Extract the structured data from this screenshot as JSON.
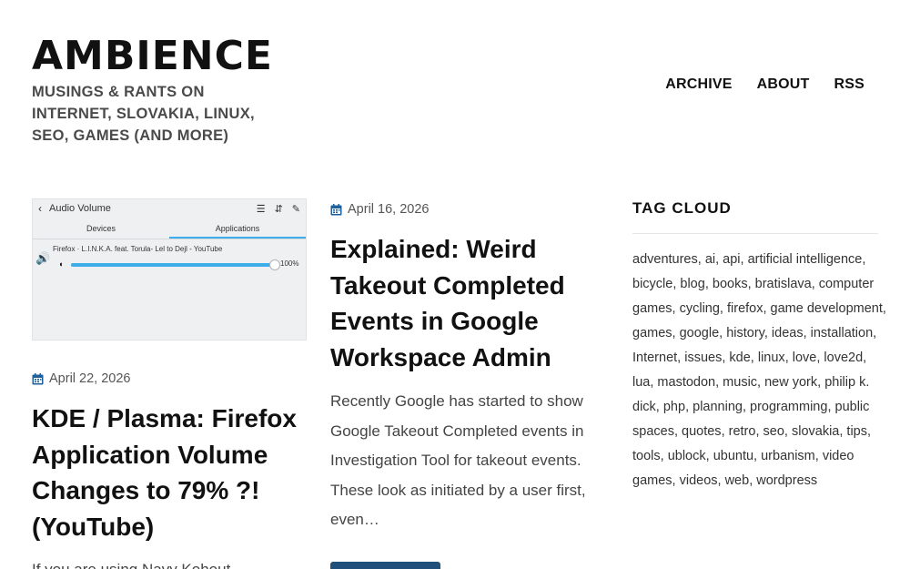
{
  "site": {
    "title": "AMBIENCE",
    "description": "MUSINGS & RANTS ON INTERNET, SLOVAKIA, LINUX, SEO, GAMES (AND MORE)"
  },
  "nav": {
    "items": [
      "ARCHIVE",
      "ABOUT",
      "RSS"
    ]
  },
  "thumbnail": {
    "window_title": "Audio Volume",
    "tabs": [
      "Devices",
      "Applications"
    ],
    "active_tab": "Applications",
    "stream_name": "Firefox · L.I.N.K.A. feat. Torula- Lel to Dejl - YouTube",
    "volume_label": "100%",
    "volume_level": 1.0,
    "accent": "#3daee9"
  },
  "posts": [
    {
      "date": "April 22, 2026",
      "title": "KDE / Plasma: Firefox Application Volume Changes to 79% ?! (YouTube)",
      "excerpt": "If you are using Navy Kohout"
    },
    {
      "date": "April 16, 2026",
      "title": "Explained: Weird Takeout Completed Events in Google Workspace Admin",
      "excerpt": "Recently Google has started to show Google Takeout Completed events in Investigation Tool for takeout events. These look as initiated by a user first, even…"
    }
  ],
  "sidebar": {
    "tag_cloud_title": "TAG CLOUD",
    "tags": [
      "adventures",
      "ai",
      "api",
      "artificial intelligence",
      "bicycle",
      "blog",
      "books",
      "bratislava",
      "computer games",
      "cycling",
      "firefox",
      "game development",
      "games",
      "google",
      "history",
      "ideas",
      "installation",
      "Internet",
      "issues",
      "kde",
      "linux",
      "love",
      "love2d",
      "lua",
      "mastodon",
      "music",
      "new york",
      "philip k. dick",
      "php",
      "planning",
      "programming",
      "public spaces",
      "quotes",
      "retro",
      "seo",
      "slovakia",
      "tips",
      "tools",
      "ublock",
      "ubuntu",
      "urbanism",
      "video games",
      "videos",
      "web",
      "wordpress"
    ]
  },
  "colors": {
    "button": "#1f4f7a",
    "calendar_icon": "#1f5f9a"
  }
}
